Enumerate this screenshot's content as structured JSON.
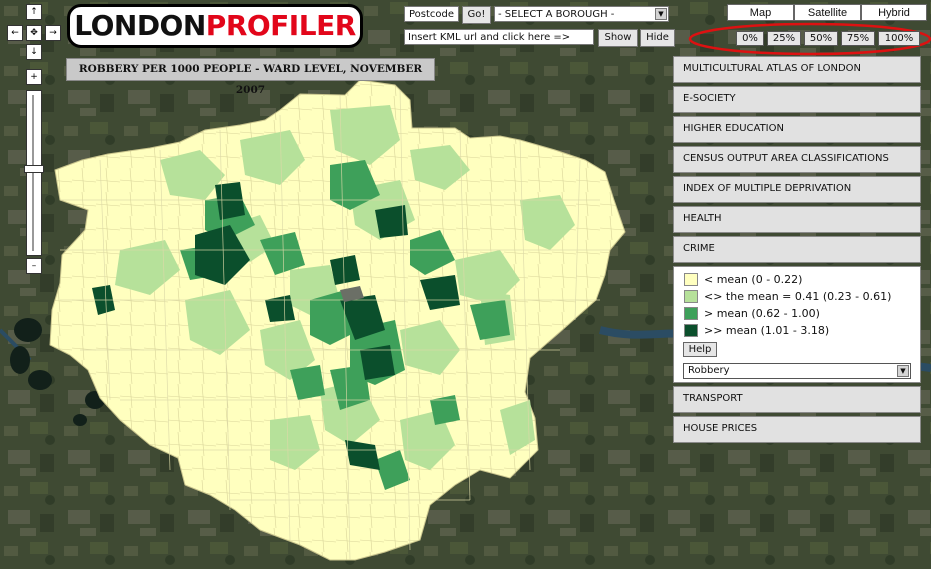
{
  "logo": {
    "part1": "LONDON",
    "part2": "PROFILER"
  },
  "nav": {
    "up": "↑",
    "down": "↓",
    "left": "←",
    "right": "→",
    "center": "✥",
    "zoom_in": "+",
    "zoom_out": "–"
  },
  "search": {
    "postcode_label": "Postcode",
    "go_label": "Go!",
    "borough_select": "- SELECT A BOROUGH -",
    "kml_input": "Insert KML url and click here =>",
    "show_label": "Show",
    "hide_label": "Hide"
  },
  "map_types": [
    "Map",
    "Satellite",
    "Hybrid"
  ],
  "opacity_options": [
    "0%",
    "25%",
    "50%",
    "75%",
    "100%"
  ],
  "map_title": "ROBBERY PER 1000 PEOPLE - WARD LEVEL, NOVEMBER 2007",
  "sections": {
    "multicultural": "MULTICULTURAL ATLAS OF LONDON",
    "esociety": "E-SOCIETY",
    "higher_ed": "HIGHER EDUCATION",
    "census": "CENSUS OUTPUT AREA CLASSIFICATIONS",
    "deprivation": "INDEX OF MULTIPLE DEPRIVATION",
    "health": "HEALTH",
    "crime": "CRIME",
    "transport": "TRANSPORT",
    "house_prices": "HOUSE PRICES"
  },
  "legend": [
    {
      "label": "< mean (0 - 0.22)",
      "color": "#ffffbf"
    },
    {
      "label": "<> the mean = 0.41 (0.23 - 0.61)",
      "color": "#b6e19a"
    },
    {
      "label": "> mean (0.62 - 1.00)",
      "color": "#3ea05a"
    },
    {
      "label": ">> mean (1.01 - 3.18)",
      "color": "#0b4f2c"
    }
  ],
  "help_label": "Help",
  "variable_select": "Robbery",
  "colors": {
    "satellite_dark": "#394530",
    "highlight_ring": "#dd1111",
    "river": "#2b4c63",
    "logo_red": "#e2061a"
  }
}
